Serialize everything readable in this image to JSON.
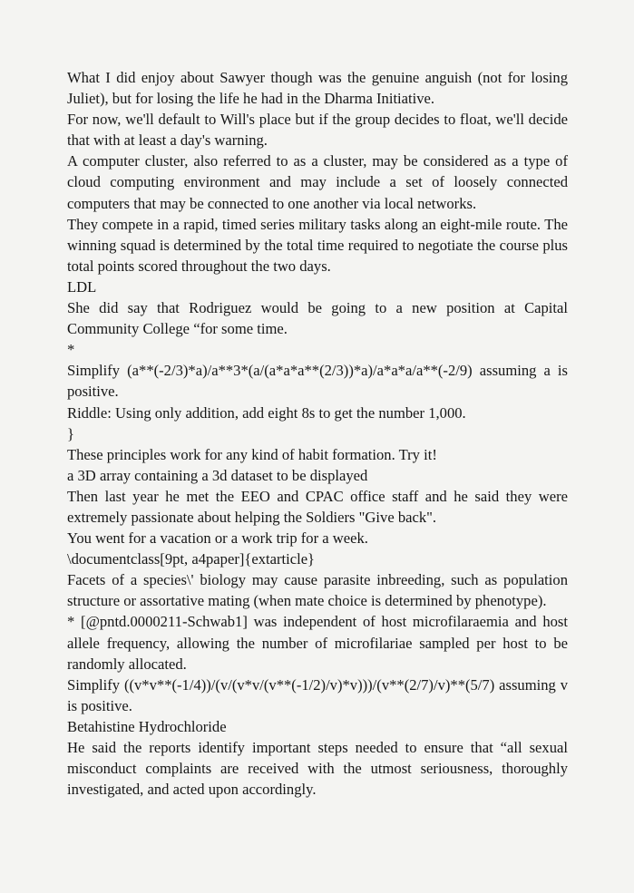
{
  "paragraphs": [
    "What I did enjoy about Sawyer though was the genuine anguish (not for losing Juliet), but for losing the life he had in the Dharma Initiative.",
    "For now, we'll default to Will's place but if the group decides to float, we'll decide that with at least a day's warning.",
    "A computer cluster, also referred to as a cluster, may be considered as a type of cloud computing environment and may include a set of loosely connected computers that may be connected to one another via local networks.",
    "They compete in a rapid, timed series military tasks along an eight-mile route. The winning squad is determined by the total time required to negotiate the course plus total points scored throughout the two days.",
    "LDL",
    "She did say that Rodriguez would be going to a new position at Capital Community College “for some time.",
    "*",
    "Simplify (a**(-2/3)*a)/a**3*(a/(a*a*a**(2/3))*a)/a*a*a/a**(-2/9) assuming a is positive.",
    "Riddle: Using only addition, add eight 8s to get the number 1,000.",
    "}",
    "These principles work for any kind of habit formation. Try it!",
    "a 3D array containing a 3d dataset to be displayed",
    "Then last year he met the EEO and CPAC office staff and he said they were extremely passionate about helping the Soldiers \"Give back\".",
    "You went for a vacation or a work trip for a week.",
    "\\documentclass[9pt, a4paper]{extarticle}",
    "Facets of a species\\' biology may cause parasite inbreeding, such as population structure or assortative mating (when mate choice is determined by phenotype).",
    "* [@pntd.0000211-Schwab1] was independent of host microfilaraemia and host allele frequency, allowing the number of microfilariae sampled per host to be randomly allocated.",
    "Simplify ((v*v**(-1/4))/(v/(v*v/(v**(-1/2)/v)*v)))/(v**(2/7)/v)**(5/7) assuming v is positive.",
    "Betahistine Hydrochloride",
    "He said the reports identify important steps needed to ensure that “all sexual misconduct complaints are received with the utmost seriousness, thoroughly investigated, and acted upon accordingly."
  ]
}
